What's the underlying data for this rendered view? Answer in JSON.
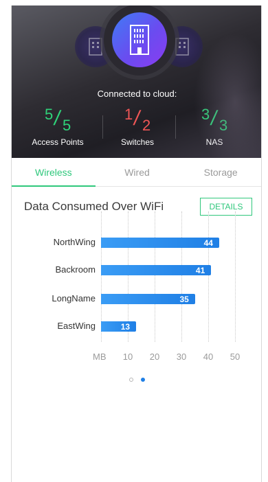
{
  "hero": {
    "status_text": "Connected to cloud:",
    "stats": [
      {
        "count": "5",
        "total": "5",
        "caption": "Access Points",
        "color": "#2fd37a"
      },
      {
        "count": "1",
        "total": "2",
        "caption": "Switches",
        "color": "#f05656"
      },
      {
        "count": "3",
        "total": "3",
        "caption": "NAS",
        "color": "#2fd37a"
      }
    ],
    "icon": "building-icon"
  },
  "tabs": [
    {
      "label": "Wireless",
      "active": true
    },
    {
      "label": "Wired",
      "active": false
    },
    {
      "label": "Storage",
      "active": false
    }
  ],
  "card": {
    "title": "Data Consumed Over WiFi",
    "details_label": "DETAILS"
  },
  "chart_data": {
    "type": "bar",
    "orientation": "horizontal",
    "title": "Data Consumed Over WiFi",
    "categories": [
      "NorthWing",
      "Backroom",
      "LongName",
      "EastWing"
    ],
    "values": [
      44,
      41,
      35,
      13
    ],
    "x_unit": "MB",
    "x_ticks": [
      10,
      20,
      30,
      40,
      50
    ],
    "xlim": [
      0,
      50
    ],
    "bar_color": "#1f7fe5",
    "grid": true
  },
  "pager": {
    "pages": 2,
    "active": 1
  }
}
